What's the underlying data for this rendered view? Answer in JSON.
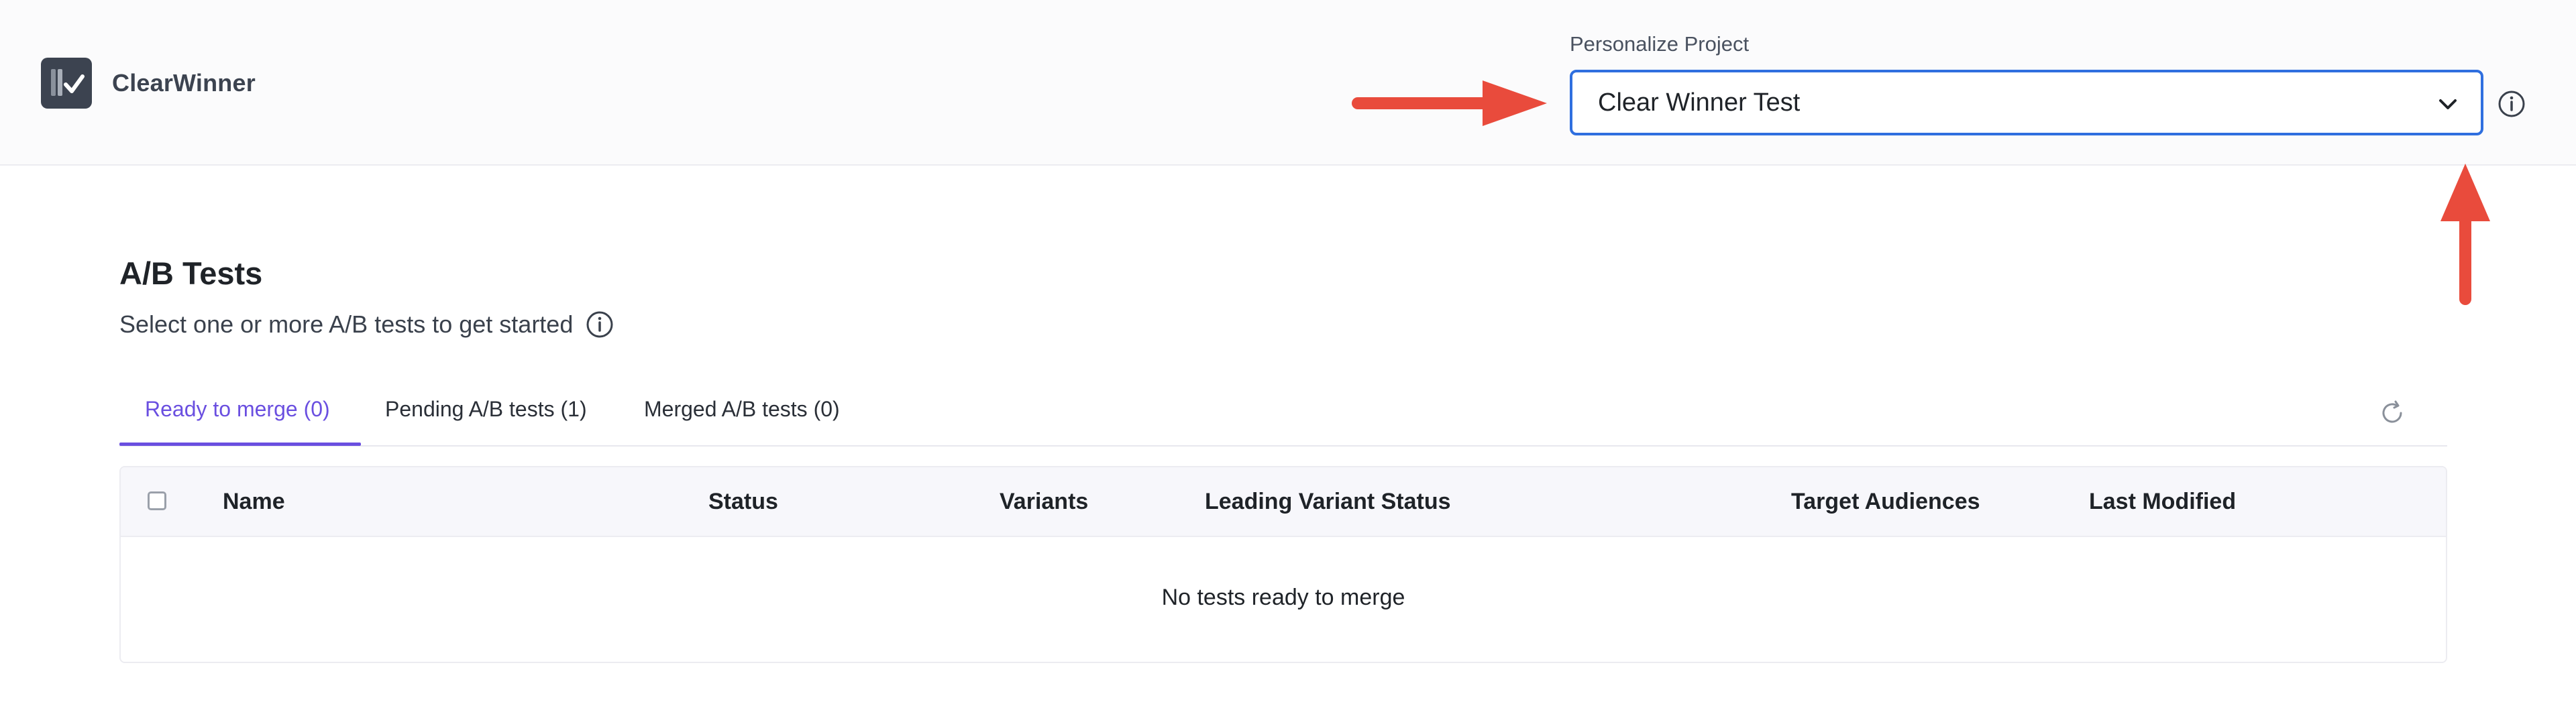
{
  "app": {
    "name": "ClearWinner"
  },
  "project": {
    "label": "Personalize Project",
    "selected": "Clear Winner Test"
  },
  "section": {
    "title": "A/B Tests",
    "subtitle": "Select one or more A/B tests to get started"
  },
  "tabs": [
    {
      "label": "Ready to merge (0)",
      "active": true
    },
    {
      "label": "Pending A/B tests (1)",
      "active": false
    },
    {
      "label": "Merged A/B tests (0)",
      "active": false
    }
  ],
  "table": {
    "columns": [
      "Name",
      "Status",
      "Variants",
      "Leading Variant Status",
      "Target Audiences",
      "Last Modified"
    ],
    "empty_message": "No tests ready to merge"
  },
  "colors": {
    "accent": "#6a4fe0",
    "select_border": "#2f6fdf",
    "annotation_arrow": "#e94b3c",
    "logo_bg": "#3c4350"
  },
  "icons": {
    "logo": "clearwinner-logo-icon",
    "dropdown": "chevron-down-icon",
    "info": "info-icon",
    "refresh": "refresh-icon"
  }
}
